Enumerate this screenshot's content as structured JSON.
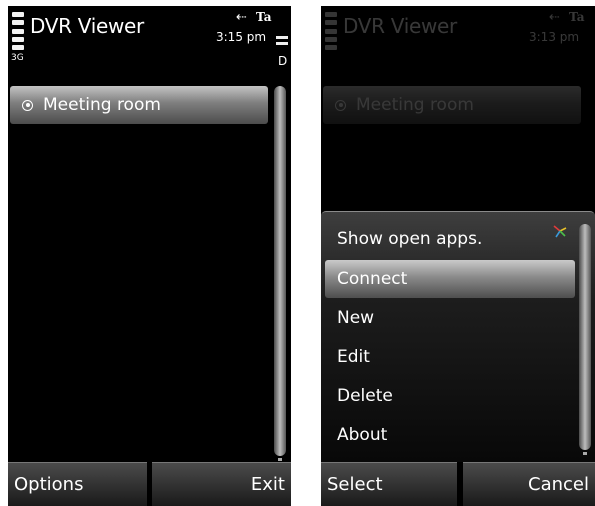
{
  "left_screen": {
    "status": {
      "title": "DVR Viewer",
      "time": "3:15 pm",
      "net_label": "3G",
      "sim_indicator": "Ta",
      "battery_indicator": "D"
    },
    "list": {
      "items": [
        {
          "label": "Meeting room"
        }
      ]
    },
    "softkeys": {
      "left": "Options",
      "right": "Exit"
    }
  },
  "right_screen": {
    "status": {
      "title": "DVR Viewer",
      "time": "3:13 pm",
      "sim_indicator": "Ta"
    },
    "background_list": {
      "items": [
        {
          "label": "Meeting room"
        }
      ]
    },
    "menu": {
      "items": [
        {
          "label": "Show open apps."
        },
        {
          "label": "Connect",
          "selected": true
        },
        {
          "label": "New"
        },
        {
          "label": "Edit"
        },
        {
          "label": "Delete"
        },
        {
          "label": "About"
        }
      ]
    },
    "softkeys": {
      "left": "Select",
      "right": "Cancel"
    }
  },
  "icons": {
    "signal": "signal-bars-icon",
    "usb": "usb-icon",
    "battery": "battery-icon",
    "radio": "radio-button-icon",
    "apps": "open-apps-icon"
  },
  "colors": {
    "screen_bg": "#000000",
    "highlight": "#9a9a9a",
    "text": "#ffffff",
    "apps_icon": [
      "#e03b3b",
      "#e7c12b",
      "#3a9ad9",
      "#4bbf4b"
    ]
  }
}
